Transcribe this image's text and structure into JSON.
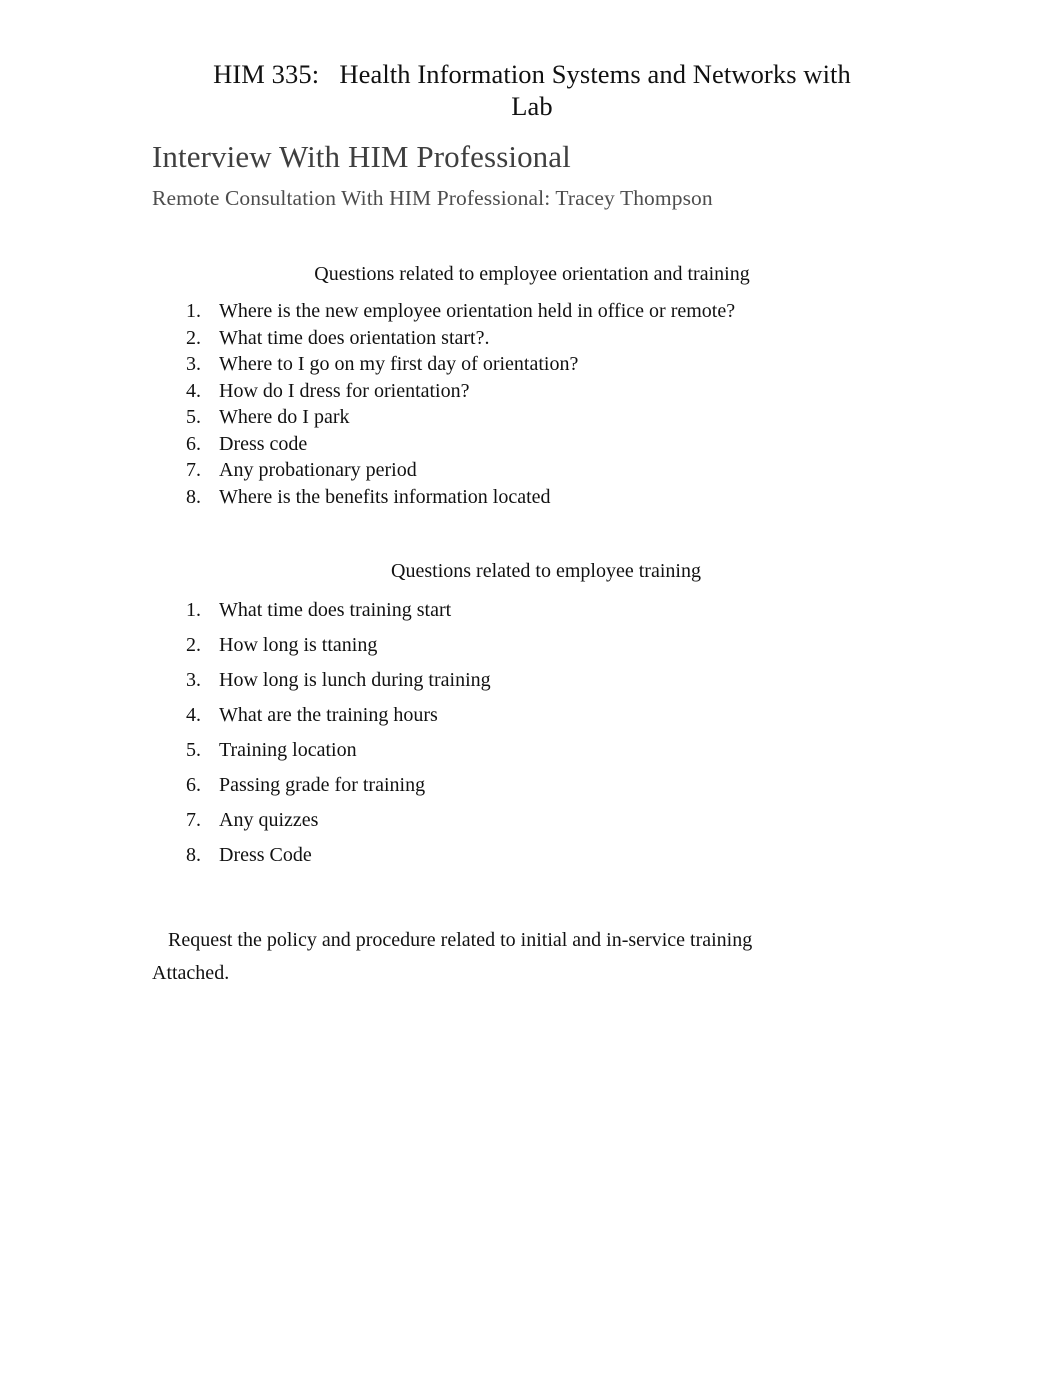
{
  "document": {
    "course_title_line1": "HIM 335:   Health Information Systems and Networks with",
    "course_title_line2": "Lab",
    "heading": "Interview With HIM Professional",
    "subtitle": "Remote Consultation With HIM Professional: Tracey Thompson",
    "sections": [
      {
        "heading": "Questions related to employee orientation and training",
        "items": [
          {
            "number": "1.",
            "text": "Where is the new employee orientation held in office or remote?"
          },
          {
            "number": "2.",
            "text": "What time does orientation start?."
          },
          {
            "number": "3.",
            "text": "Where to I go on my first day of orientation?"
          },
          {
            "number": "4.",
            "text": "How do I dress for orientation?"
          },
          {
            "number": "5.",
            "text": "Where do I park"
          },
          {
            "number": "6.",
            "text": "Dress code"
          },
          {
            "number": "7.",
            "text": "Any probationary period"
          },
          {
            "number": "8.",
            "text": "Where is the benefits information located"
          }
        ]
      },
      {
        "heading": "Questions related to employee training",
        "items": [
          {
            "number": "1.",
            "text": "What time does training start"
          },
          {
            "number": "2.",
            "text": "How long is ttaning"
          },
          {
            "number": "3.",
            "text": "How long is lunch during training"
          },
          {
            "number": "4.",
            "text": "What are the training hours"
          },
          {
            "number": "5.",
            "text": "Training location"
          },
          {
            "number": "6.",
            "text": "Passing grade for training"
          },
          {
            "number": "7.",
            "text": "Any quizzes"
          },
          {
            "number": "8.",
            "text": "Dress Code"
          }
        ]
      }
    ],
    "closing_paragraph": "Request the policy and procedure related to initial and in-service training Attached.",
    "colors": {
      "page_background": "#ffffff",
      "body_text": "#111111",
      "heading_text": "#3f3f3f",
      "subtitle_text": "#4d4d4d"
    }
  }
}
